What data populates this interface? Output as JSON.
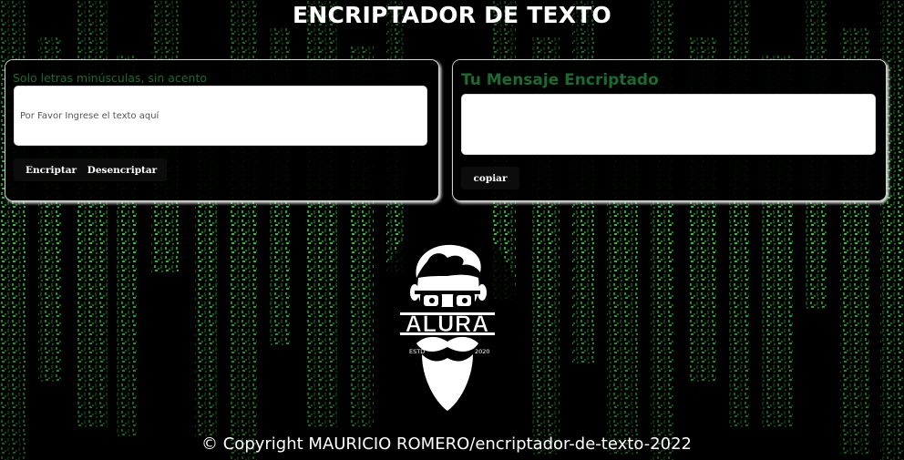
{
  "header": {
    "title": "ENCRIPTADOR DE TEXTO"
  },
  "encoder": {
    "hint": "Solo letras minúsculas, sin acento",
    "input_placeholder": "Por Favor Ingrese el texto aquí",
    "input_value": "",
    "encrypt_label": "Encriptar",
    "decrypt_label": "Desencriptar"
  },
  "decoder": {
    "title": "Tu Mensaje Encriptado",
    "output_value": "",
    "copy_label": "copiar"
  },
  "logo": {
    "brand": "ALURA",
    "left_tag": "ESTD",
    "right_tag": "2020",
    "icon": "bearded-man-glasses-logo"
  },
  "footer": {
    "text": "© Copyright MAURICIO ROMERO/encriptador-de-texto-2022"
  },
  "colors": {
    "background": "#000000",
    "matrix_green": "#22c22b",
    "accent_green": "#1c6b2e",
    "panel": "#000000",
    "button": "#0c0c0c",
    "text": "#ffffff"
  }
}
